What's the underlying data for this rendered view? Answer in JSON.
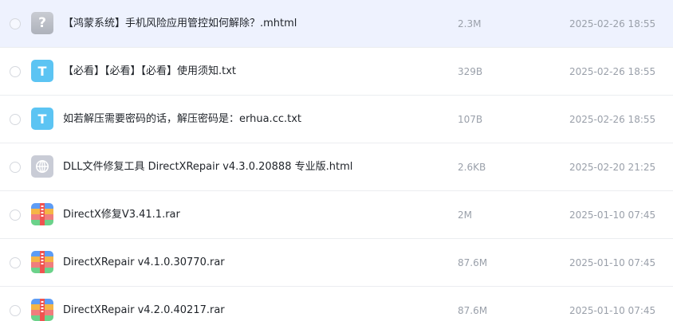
{
  "files": [
    {
      "name": "【鸿蒙系统】手机风险应用管控如何解除？.mhtml",
      "size": "2.3M",
      "date": "2025-02-26 18:55",
      "icon": "unknown-file-icon",
      "icon_glyph": "?"
    },
    {
      "name": "【必看】【必看】【必看】使用须知.txt",
      "size": "329B",
      "date": "2025-02-26 18:55",
      "icon": "txt-file-icon",
      "icon_glyph": "T"
    },
    {
      "name": "如若解压需要密码的话，解压密码是：erhua.cc.txt",
      "size": "107B",
      "date": "2025-02-26 18:55",
      "icon": "txt-file-icon",
      "icon_glyph": "T"
    },
    {
      "name": "DLL文件修复工具 DirectXRepair v4.3.0.20888 专业版.html",
      "size": "2.6KB",
      "date": "2025-02-20 21:25",
      "icon": "html-file-icon"
    },
    {
      "name": "DirectX修复V3.41.1.rar",
      "size": "2M",
      "date": "2025-01-10 07:45",
      "icon": "archive-file-icon"
    },
    {
      "name": "DirectXRepair v4.1.0.30770.rar",
      "size": "87.6M",
      "date": "2025-01-10 07:45",
      "icon": "archive-file-icon"
    },
    {
      "name": "DirectXRepair v4.2.0.40217.rar",
      "size": "87.6M",
      "date": "2025-01-10 07:45",
      "icon": "archive-file-icon"
    }
  ],
  "colors": {
    "selected_row_bg": "#eef2fe",
    "txt_icon": "#5cc4f3",
    "name_text": "#1f2329",
    "meta_text": "#9aa0aa"
  }
}
